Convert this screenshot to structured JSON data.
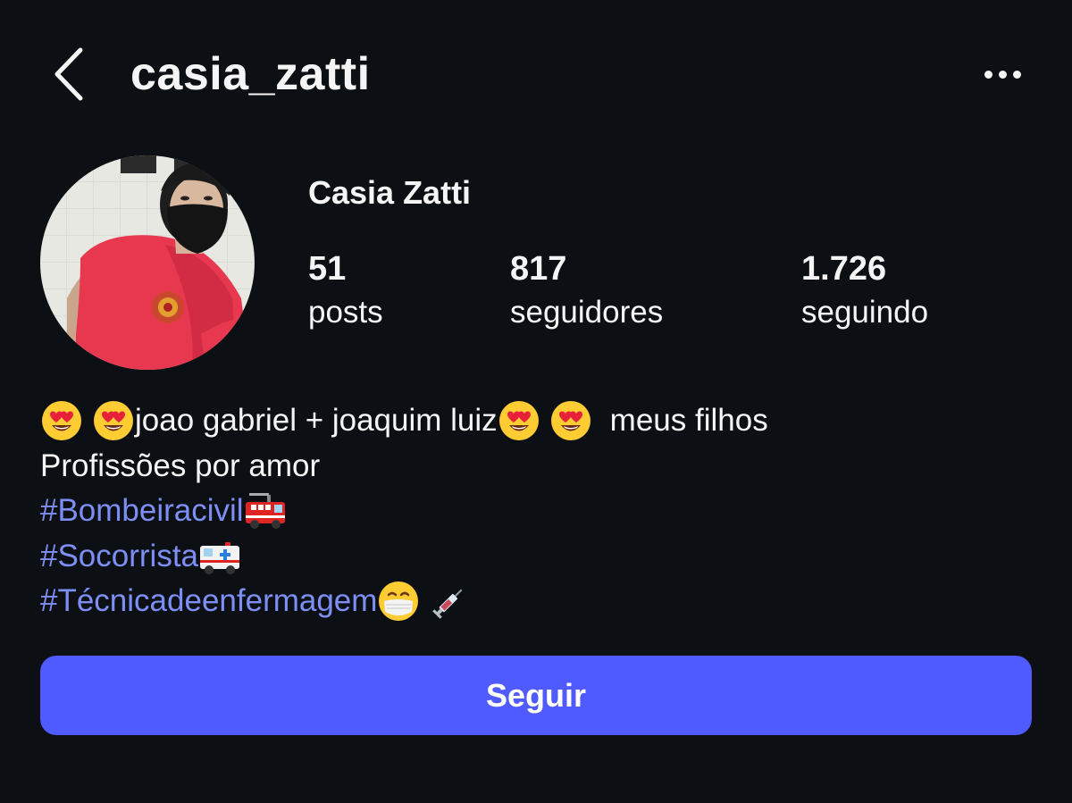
{
  "header": {
    "username": "casia_zatti"
  },
  "profile": {
    "display_name": "Casia Zatti",
    "stats": {
      "posts": {
        "value": "51",
        "label": "posts"
      },
      "followers": {
        "value": "817",
        "label": "seguidores"
      },
      "following": {
        "value": "1.726",
        "label": "seguindo"
      }
    }
  },
  "bio": {
    "line1_text": "joao gabriel + joaquim luiz",
    "line1_tail": "meus filhos",
    "line2": "Profissões por amor",
    "hashtag1": "#Bombeiracivil",
    "hashtag2": "#Socorrista",
    "hashtag3": "#Técnicadeenfermagem",
    "emojis": [
      "heart-eyes",
      "heart-eyes",
      "heart-eyes",
      "heart-eyes",
      "fire-engine",
      "ambulance",
      "face-with-medical-mask",
      "syringe"
    ]
  },
  "actions": {
    "follow_label": "Seguir"
  },
  "colors": {
    "background": "#0c1014",
    "text": "#f5f5f5",
    "hashtag": "#7d8ff5",
    "follow_button": "#4f5bff"
  },
  "icons": {
    "back": "chevron-left-icon",
    "more": "more-horizontal-icon"
  }
}
